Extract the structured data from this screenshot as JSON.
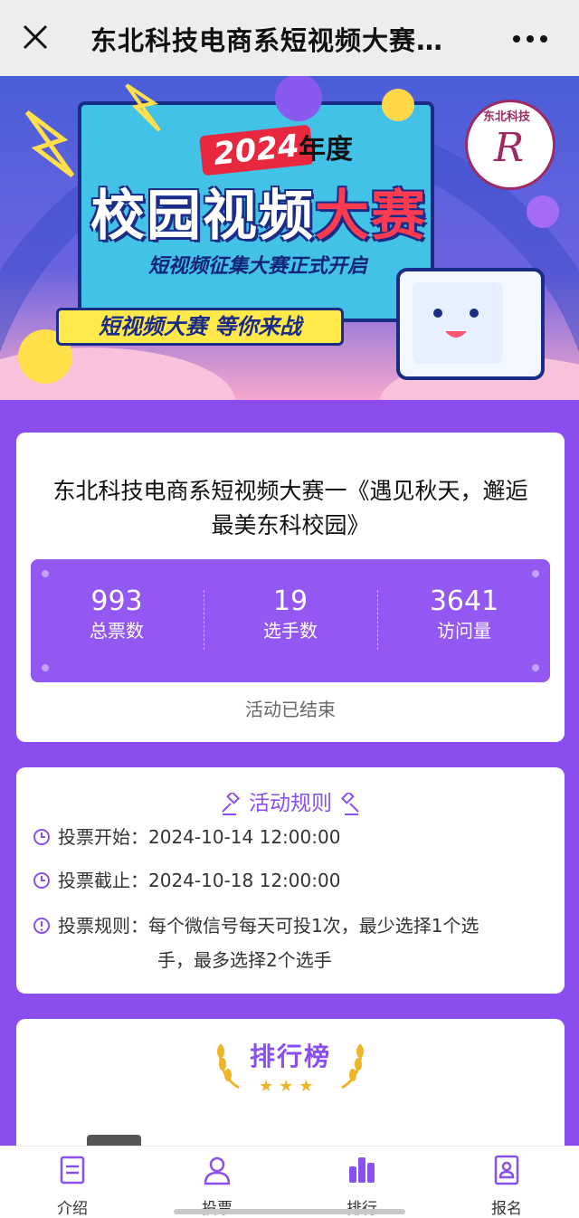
{
  "topbar": {
    "title": "东北科技电商系短视频大赛…",
    "close_icon": "close-icon",
    "more_icon": "more-icon"
  },
  "banner": {
    "year": "2024",
    "year_suffix": "年度",
    "main_title_1": "校园视频",
    "main_title_2": "大赛",
    "subtitle": "短视频征集大赛正式开启",
    "slogan": "短视频大赛 等你来战",
    "logo_text": "东北科技"
  },
  "activity": {
    "title": "东北科技电商系短视频大赛一《遇见秋天，邂逅最美东科校园》",
    "stats": [
      {
        "value": "993",
        "label": "总票数"
      },
      {
        "value": "19",
        "label": "选手数"
      },
      {
        "value": "3641",
        "label": "访问量"
      }
    ],
    "status": "活动已结束"
  },
  "rules": {
    "heading": "活动规则",
    "vote_start_label": "投票开始：",
    "vote_start_value": "2024-10-14 12:00:00",
    "vote_end_label": "投票截止：",
    "vote_end_value": "2024-10-18 12:00:00",
    "vote_rule_label": "投票规则：",
    "vote_rule_line1": "每个微信号每天可投1次，最少选择1个选",
    "vote_rule_line2": "手，最多选择2个选手"
  },
  "ranking": {
    "heading": "排行榜",
    "stars": "★★★"
  },
  "tabbar": {
    "items": [
      {
        "label": "介绍",
        "icon": "document-icon"
      },
      {
        "label": "投票",
        "icon": "user-icon"
      },
      {
        "label": "排行",
        "icon": "bar-chart-icon"
      },
      {
        "label": "报名",
        "icon": "id-card-icon"
      }
    ]
  },
  "colors": {
    "accent": "#8b4df0",
    "stats_bg": "#9358f2",
    "star": "#f0b429"
  }
}
